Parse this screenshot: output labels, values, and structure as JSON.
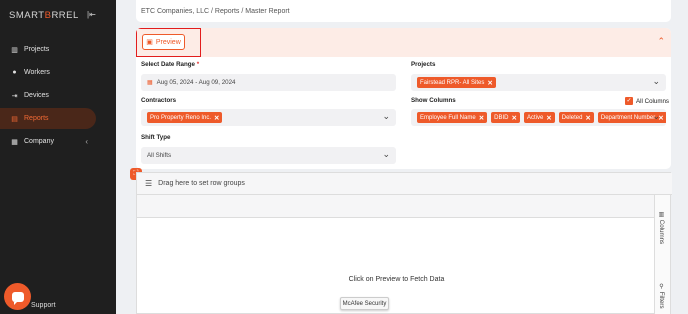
{
  "brand": {
    "name_left": "SMART",
    "name_accent": "B",
    "name_right": "RREL"
  },
  "sidebar": {
    "items": [
      {
        "label": "Projects",
        "icon": "projects-icon"
      },
      {
        "label": "Workers",
        "icon": "workers-icon"
      },
      {
        "label": "Devices",
        "icon": "devices-icon"
      },
      {
        "label": "Reports",
        "icon": "reports-icon",
        "active": true
      },
      {
        "label": "Company",
        "icon": "company-icon"
      }
    ],
    "support_label": "Support"
  },
  "breadcrumb": "ETC Companies, LLC  /  Reports  /  Master Report",
  "preview_label": "Preview",
  "filters": {
    "date_range": {
      "label": "Select Date Range",
      "required_mark": "*",
      "value": "Aug 05, 2024 - Aug 09, 2024"
    },
    "projects": {
      "label": "Projects",
      "tags": [
        "Fairstead RPR- All Sites"
      ]
    },
    "contractors": {
      "label": "Contractors",
      "tags": [
        "Pro Property Reno Inc."
      ]
    },
    "show_columns": {
      "label": "Show Columns",
      "all_columns_label": "All Columns",
      "all_columns_checked": true,
      "tags": [
        "Employee Full Name",
        "DBID",
        "Active",
        "Deleted",
        "Department Number"
      ]
    },
    "shift_type": {
      "label": "Shift Type",
      "value": "All Shifts"
    }
  },
  "grid": {
    "group_bar_text": "Drag here to set row groups",
    "empty_message": "Click on Preview to Fetch Data",
    "side_tabs": [
      "Columns",
      "Filters"
    ]
  },
  "popup": {
    "mcafee_label": "McAfee Security"
  },
  "colors": {
    "accent": "#ee5a2a",
    "sidebar_bg": "#1f1f1f",
    "highlight_box": "#e21d1d"
  }
}
